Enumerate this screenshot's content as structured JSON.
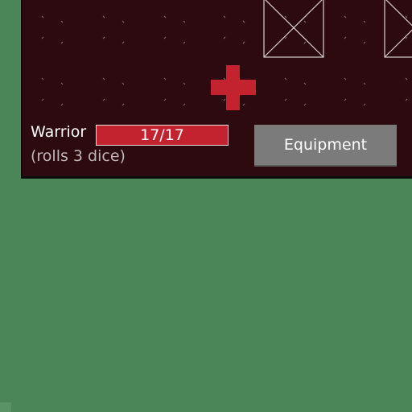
{
  "character": {
    "name": "Warrior",
    "dice_note": "(rolls 3 dice)",
    "hp_current": 17,
    "hp_max": 17,
    "hp_text": "17/17"
  },
  "equipment_button": {
    "label": "Equipment"
  },
  "board": {
    "tile_icons": [
      "crossed-box-icon",
      "crossed-box-icon"
    ],
    "center_icon": "red-cross-icon"
  },
  "colors": {
    "table_green": "#4a8657",
    "panel_bg": "#2d0a10",
    "hp_red": "#c2232f",
    "button_gray": "#7b7b7b"
  }
}
